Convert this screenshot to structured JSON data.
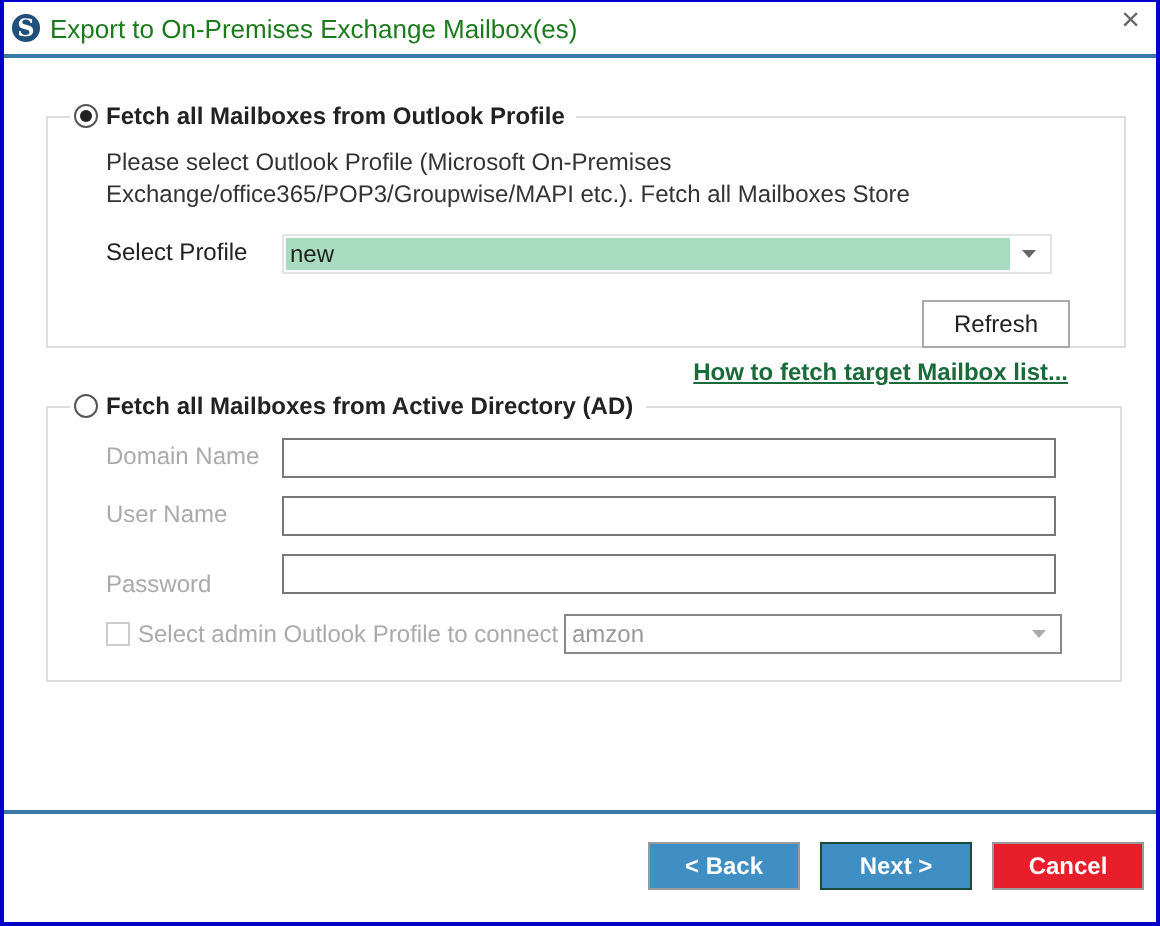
{
  "window": {
    "logo": "S",
    "title": "Export to On-Premises Exchange Mailbox(es)",
    "close": "×"
  },
  "outlook_section": {
    "label": "Fetch all Mailboxes from Outlook Profile",
    "selected": true,
    "description": "Please select Outlook Profile (Microsoft On-Premises Exchange/office365/POP3/Groupwise/MAPI etc.). Fetch all Mailboxes Store",
    "profile_label": "Select Profile",
    "profile_value": "new",
    "refresh": "Refresh"
  },
  "help_link": "How to fetch target Mailbox list...",
  "ad_section": {
    "label": "Fetch all Mailboxes from Active Directory (AD)",
    "selected": false,
    "disabled": true,
    "fields": [
      {
        "label": "Domain Name"
      },
      {
        "label": "User Name"
      },
      {
        "label": "Password"
      }
    ],
    "admin_checkbox": {
      "label": "Select admin Outlook Profile to connect",
      "checked": false
    },
    "admin_profile_value": "amzon"
  },
  "buttons": [
    {
      "label": "< Back",
      "kind": "back"
    },
    {
      "label": "Next >",
      "kind": "next"
    },
    {
      "label": "Cancel",
      "kind": "cancel"
    }
  ]
}
